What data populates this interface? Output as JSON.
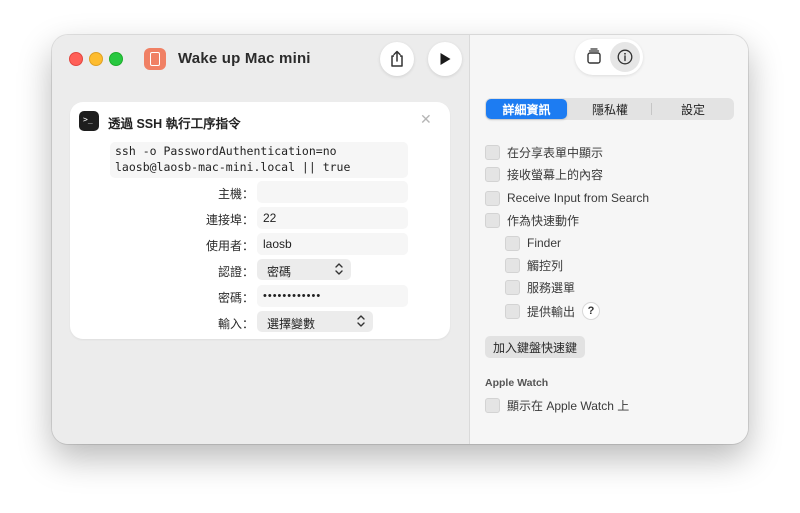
{
  "window": {
    "title": "Wake up Mac mini"
  },
  "toolbar": {
    "share_icon": "share-icon",
    "run_icon": "play-icon"
  },
  "action": {
    "title": "透過 SSH 執行工序指令",
    "script_lines": [
      "ssh -o PasswordAuthentication=no",
      "laosb@laosb-mac-mini.local || true"
    ],
    "fields": {
      "host": {
        "label": "主機：",
        "value": ""
      },
      "port": {
        "label": "連接埠：",
        "value": "22"
      },
      "user": {
        "label": "使用者：",
        "value": "laosb"
      },
      "auth": {
        "label": "認證：",
        "value": "密碼"
      },
      "password": {
        "label": "密碼：",
        "value": "••••••••••••"
      },
      "input": {
        "label": "輸入：",
        "value": "選擇變數"
      }
    }
  },
  "inspector": {
    "tabs": [
      "詳細資訊",
      "隱私權",
      "設定"
    ],
    "active_tab": "詳細資訊",
    "options": {
      "share_sheet": "在分享表單中顯示",
      "receive_screen": "接收螢幕上的內容",
      "receive_search": "Receive Input from Search",
      "quick_action": "作為快速動作",
      "finder": "Finder",
      "touchbar": "觸控列",
      "services": "服務選單",
      "provide_output": "提供輸出"
    },
    "help_label": "?",
    "add_shortcut_label": "加入鍵盤快速鍵",
    "apple_watch_heading": "Apple Watch",
    "apple_watch_option": "顯示在 Apple Watch 上"
  }
}
